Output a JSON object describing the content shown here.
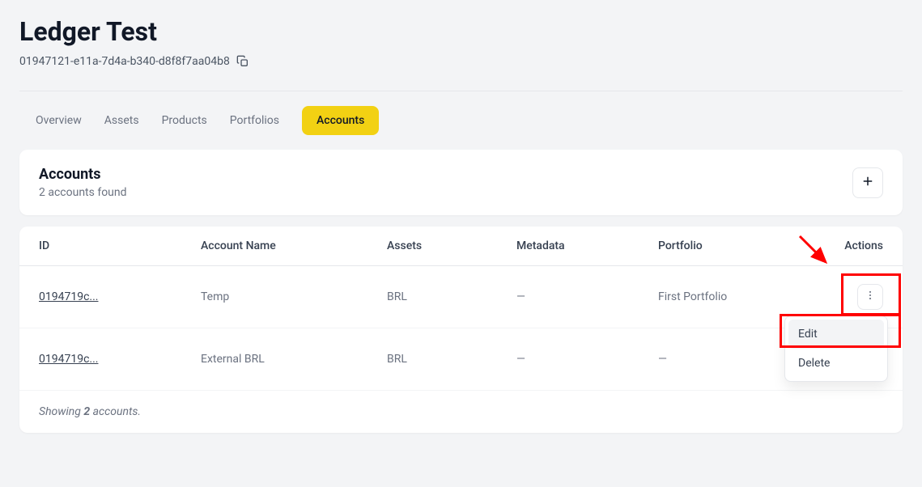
{
  "header": {
    "title": "Ledger Test",
    "ledger_id": "01947121-e11a-7d4a-b340-d8f8f7aa04b8"
  },
  "tabs": [
    {
      "label": "Overview",
      "active": false
    },
    {
      "label": "Assets",
      "active": false
    },
    {
      "label": "Products",
      "active": false
    },
    {
      "label": "Portfolios",
      "active": false
    },
    {
      "label": "Accounts",
      "active": true
    }
  ],
  "card": {
    "title": "Accounts",
    "subtitle": "2 accounts found"
  },
  "table": {
    "columns": [
      "ID",
      "Account Name",
      "Assets",
      "Metadata",
      "Portfolio",
      "Actions"
    ],
    "rows": [
      {
        "id": "0194719c...",
        "name": "Temp",
        "assets": "BRL",
        "metadata": "—",
        "portfolio": "First Portfolio"
      },
      {
        "id": "0194719c...",
        "name": "External BRL",
        "assets": "BRL",
        "metadata": "—",
        "portfolio": "—"
      }
    ],
    "footer_prefix": "Showing ",
    "footer_count": "2",
    "footer_suffix": " accounts."
  },
  "dropdown": {
    "items": [
      {
        "label": "Edit",
        "hover": true
      },
      {
        "label": "Delete",
        "hover": false
      }
    ]
  }
}
